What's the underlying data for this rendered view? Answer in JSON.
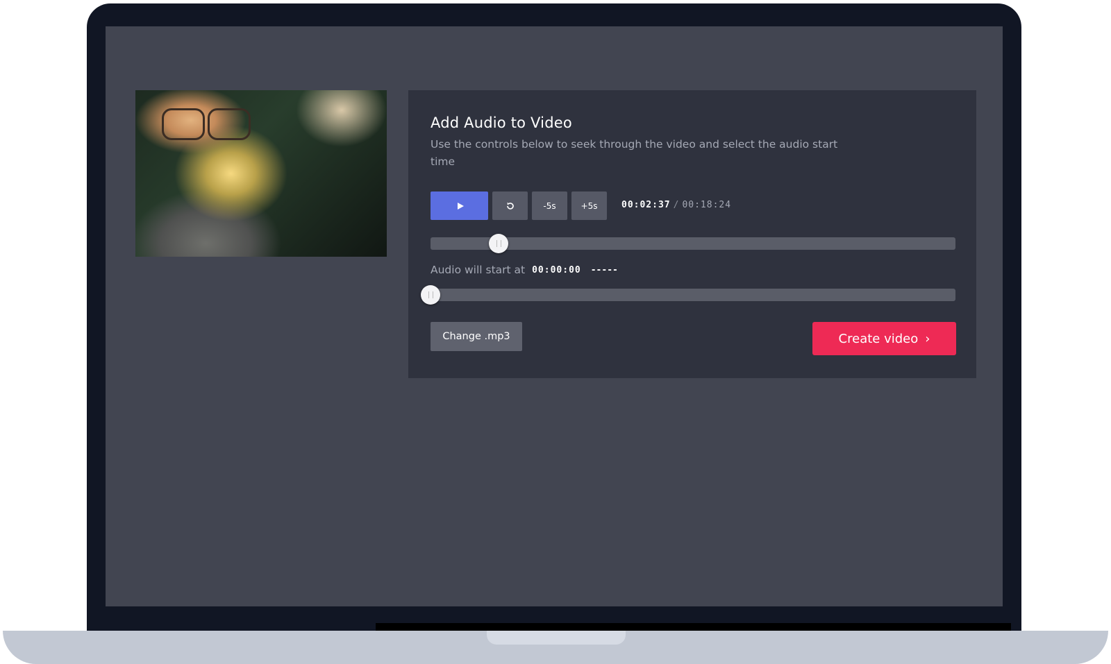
{
  "panel": {
    "title": "Add Audio to Video",
    "subtitle": "Use the controls below to seek through the video and select the audio start time"
  },
  "controls": {
    "play_icon": "play-icon",
    "reset_icon": "reset-icon",
    "minus_label": "-5s",
    "plus_label": "+5s",
    "current_time": "00:02:37",
    "separator": "/",
    "total_time": "00:18:24"
  },
  "seek": {
    "progress_fraction": 0.13
  },
  "audio": {
    "label": "Audio will start at",
    "start_time": "00:00:00",
    "dash": "-----",
    "progress_fraction": 0.0
  },
  "actions": {
    "change_label": "Change .mp3",
    "create_label": "Create video",
    "create_icon": "chevron-right-icon"
  },
  "colors": {
    "play_button": "#5b6ee1",
    "create_button": "#ee2a55",
    "panel": "#2f323e",
    "screen": "#424551"
  }
}
